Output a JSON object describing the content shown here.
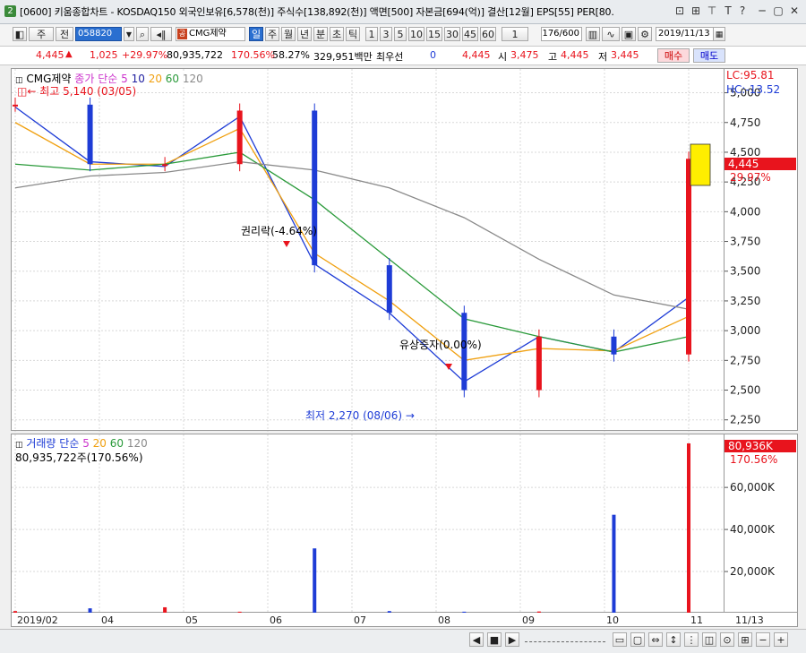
{
  "window": {
    "badge": "2",
    "title": "[0600] 키움종합차트 - KOSDAQ150 외국인보유[6,578(천)] 주식수[138,892(천)] 액면[500] 자본금[694(억)] 결산[12월] EPS[55] PER[80.",
    "icons": [
      "layout-icon",
      "tile-icon",
      "pin-icon",
      "text-icon",
      "help-icon"
    ],
    "icon_glyphs": [
      "⊡",
      "⊞",
      "⊤",
      "T",
      "?"
    ]
  },
  "toolbar": {
    "period_label": "주",
    "prev_label": "전",
    "code": "058820",
    "stock_name": "CMG제약",
    "day_label": "일",
    "week_label": "주",
    "month_label": "월",
    "year_label": "년",
    "minute_label": "분",
    "second_label": "초",
    "tick_label": "틱",
    "intervals": [
      "1",
      "3",
      "5",
      "10",
      "15",
      "30",
      "45",
      "60"
    ],
    "multiplier": "1",
    "count": "176/600",
    "date": "2019/11/13"
  },
  "info": {
    "price": "4,445",
    "change": "1,025",
    "change_pct": "+29.97%",
    "volume": "80,935,722",
    "vol_pct": "170.56%",
    "vol_ratio": "58.27%",
    "amount": "329,951백만",
    "best_label": "최우선",
    "best_value": "0",
    "current": "4,445",
    "open_label": "시",
    "open": "3,475",
    "high_label": "고",
    "high": "4,445",
    "low_label": "저",
    "low": "3,445",
    "buy_label": "매수",
    "sell_label": "매도"
  },
  "legend": {
    "stock": "CMG제약",
    "ma_label": "종가 단순",
    "ma_periods": [
      "5",
      "10",
      "20",
      "60",
      "120"
    ],
    "high_note": "최고 5,140 (03/05)",
    "low_note": "최저 2,270 (08/06)",
    "event1": "권리락(-4.64%)",
    "event2": "유상증자(0.00%)",
    "lc": "LC:95.81",
    "hc": "HC:-13.52",
    "last_price": "4,445",
    "last_pct": "29.97%",
    "vol_title": "거래량 단순",
    "vol_periods": [
      "5",
      "20",
      "60",
      "120"
    ],
    "vol_value": "80,935,722주(170.56%)",
    "vol_last": "80,936K",
    "vol_last_pct": "170.56%"
  },
  "colors": {
    "up": "#e8141d",
    "down": "#1e3cd6",
    "ma5": "#1e3cd6",
    "ma10": "#2020a0",
    "ma20": "#f0a010",
    "ma60": "#2a9a3a",
    "ma120": "#8a8a8a",
    "vol_ma5": "#cc33cc",
    "vol_ma20": "#f0a010"
  },
  "chart_data": [
    {
      "type": "line",
      "title": "CMG제약",
      "x": [
        "2019/02",
        "2019/03",
        "2019/04",
        "2019/05",
        "2019/06",
        "2019/07",
        "2019/08",
        "2019/09",
        "2019/10",
        "2019/11/13"
      ],
      "series": [
        {
          "name": "종가",
          "values": [
            4900,
            4400,
            4400,
            4850,
            3550,
            3150,
            2500,
            2950,
            2800,
            4445
          ]
        },
        {
          "name": "5",
          "values": [
            4880,
            4420,
            4380,
            4800,
            3560,
            3150,
            2570,
            2950,
            2820,
            3280
          ]
        },
        {
          "name": "20",
          "values": [
            4750,
            4400,
            4400,
            4700,
            3650,
            3250,
            2750,
            2850,
            2830,
            3120
          ]
        },
        {
          "name": "60",
          "values": [
            4400,
            4350,
            4400,
            4500,
            4100,
            3600,
            3100,
            2950,
            2820,
            2950
          ]
        },
        {
          "name": "120",
          "values": [
            4200,
            4300,
            4330,
            4420,
            4350,
            4200,
            3950,
            3600,
            3300,
            3180
          ]
        }
      ],
      "y_ticks": [
        2250,
        2500,
        2750,
        3000,
        3250,
        3500,
        3750,
        4000,
        4250,
        4500,
        4750,
        5000
      ],
      "x_ticks": [
        "2019/02",
        "04",
        "05",
        "06",
        "07",
        "08",
        "09",
        "10",
        "11",
        "11/13"
      ],
      "ylim": [
        2150,
        5200
      ],
      "grid": true
    },
    {
      "type": "bar",
      "title": "거래량",
      "categories": [
        "2019/02",
        "04",
        "05",
        "06",
        "07",
        "08",
        "09",
        "10",
        "11/12",
        "11/13"
      ],
      "values": [
        1200,
        2500,
        3000,
        900,
        31000,
        1200,
        900,
        1000,
        47000,
        80936
      ],
      "y_ticks": [
        20000,
        40000,
        60000
      ],
      "ylim": [
        0,
        80936
      ],
      "unit": "K"
    }
  ],
  "bottom": {
    "icons": [
      "prev-icon",
      "stop-icon",
      "next-icon",
      "zoom-out-icon",
      "zoom-in-icon"
    ],
    "glyphs": [
      "◀",
      "■",
      "▶",
      "−",
      "+"
    ]
  }
}
